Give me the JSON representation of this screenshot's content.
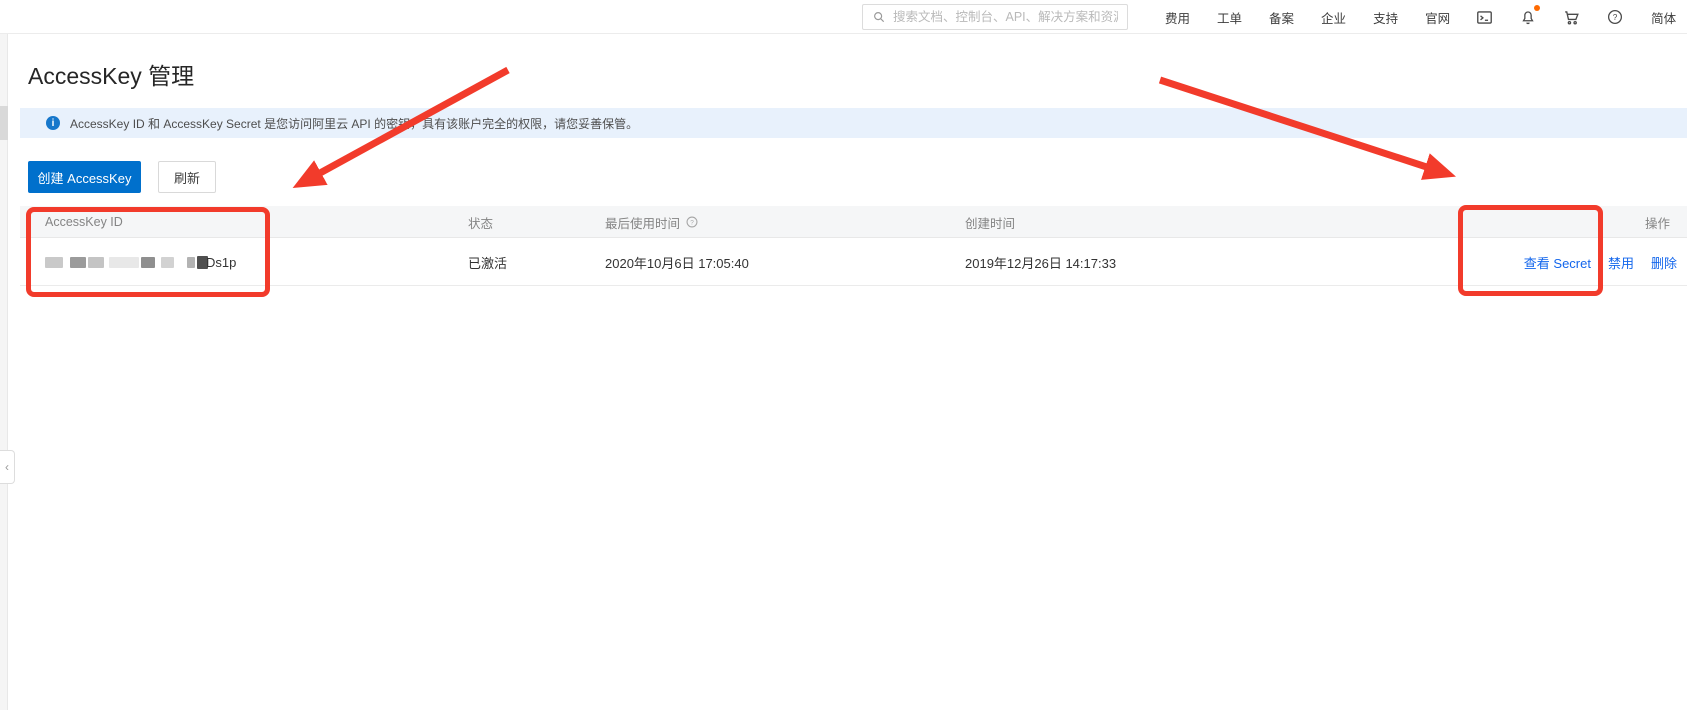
{
  "navbar": {
    "search_placeholder": "搜索文档、控制台、API、解决方案和资源",
    "links": [
      "费用",
      "工单",
      "备案",
      "企业",
      "支持",
      "官网"
    ],
    "language": "简体",
    "icons": [
      "terminal-icon",
      "bell-icon",
      "cart-icon",
      "help-icon"
    ]
  },
  "page": {
    "title": "AccessKey 管理",
    "banner_text": "AccessKey ID 和 AccessKey Secret 是您访问阿里云 API 的密钥，具有该账户完全的权限，请您妥善保管。",
    "create_button_label": "创建 AccessKey",
    "refresh_button_label": "刷新"
  },
  "table": {
    "headers": {
      "id": "AccessKey ID",
      "status": "状态",
      "last_used": "最后使用时间",
      "created": "创建时间",
      "actions": "操作"
    },
    "row": {
      "id_suffix": "Ds1p",
      "status": "已激活",
      "last_used": "2020年10月6日 17:05:40",
      "created": "2019年12月26日 14:17:33",
      "actions": [
        "查看 Secret",
        "禁用",
        "删除"
      ]
    }
  },
  "colors": {
    "primary_button": "#0070cc",
    "link": "#1366ec",
    "annotation_red": "#f23b2b",
    "banner_bg": "#e8f1fc",
    "notification_dot": "#ff6a00"
  }
}
